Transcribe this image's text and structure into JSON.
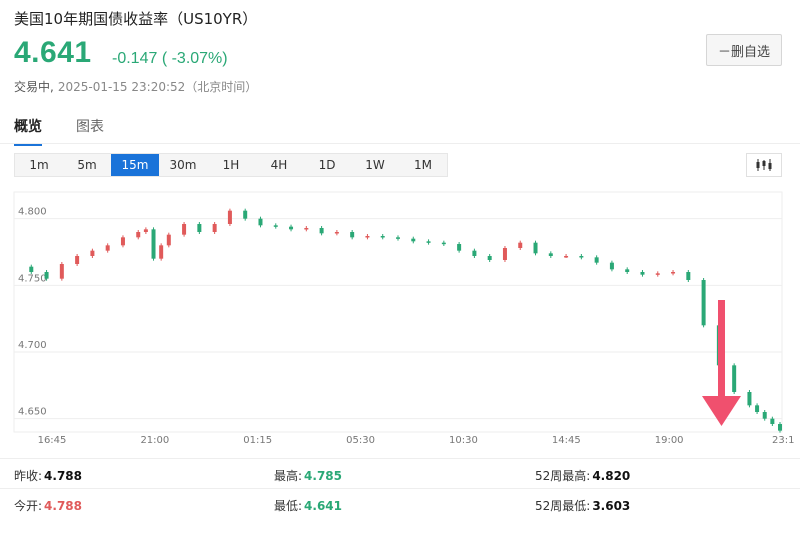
{
  "header": {
    "title": "美国10年期国债收益率（US10YR）",
    "price": "4.641",
    "change": "-0.147 ( -3.07%)",
    "status": "交易中,",
    "timestamp": "2025-01-15 23:20:52（北京时间）",
    "watchlist_label": "－删自选"
  },
  "tabs": [
    {
      "label": "概览",
      "active": true
    },
    {
      "label": "图表",
      "active": false
    }
  ],
  "periods": [
    {
      "label": "1m",
      "active": false
    },
    {
      "label": "5m",
      "active": false
    },
    {
      "label": "15m",
      "active": true
    },
    {
      "label": "30m",
      "active": false
    },
    {
      "label": "1H",
      "active": false
    },
    {
      "label": "4H",
      "active": false
    },
    {
      "label": "1D",
      "active": false
    },
    {
      "label": "1W",
      "active": false
    },
    {
      "label": "1M",
      "active": false
    }
  ],
  "chart_data": {
    "type": "line",
    "title": "",
    "xlabel": "",
    "ylabel": "",
    "x_ticks": [
      "16:45",
      "21:00",
      "01:15",
      "05:30",
      "10:30",
      "14:45",
      "19:00",
      "23:1"
    ],
    "y_ticks": [
      "4.800",
      "4.750",
      "4.700",
      "4.650"
    ],
    "ylim": [
      4.64,
      4.82
    ],
    "series": [
      {
        "x": [
          0,
          2,
          4,
          6,
          8,
          10,
          12,
          14,
          16,
          17,
          18,
          19,
          20,
          22,
          24,
          26,
          28,
          30,
          32,
          34,
          36,
          38,
          40,
          42,
          44,
          46,
          48,
          50,
          52,
          54,
          56,
          58,
          60,
          62,
          64,
          66,
          68,
          70,
          72,
          74,
          76,
          78,
          80,
          82,
          84,
          86,
          88,
          90,
          92,
          94,
          96,
          97,
          98,
          99,
          100
        ],
        "values": [
          4.764,
          4.76,
          4.755,
          4.766,
          4.772,
          4.776,
          4.78,
          4.786,
          4.79,
          4.792,
          4.77,
          4.78,
          4.788,
          4.796,
          4.79,
          4.796,
          4.806,
          4.8,
          4.795,
          4.794,
          4.792,
          4.793,
          4.789,
          4.79,
          4.786,
          4.787,
          4.786,
          4.785,
          4.783,
          4.782,
          4.781,
          4.776,
          4.772,
          4.769,
          4.778,
          4.782,
          4.774,
          4.772,
          4.772,
          4.771,
          4.767,
          4.762,
          4.76,
          4.758,
          4.759,
          4.76,
          4.754,
          4.72,
          4.69,
          4.67,
          4.66,
          4.655,
          4.65,
          4.646,
          4.641
        ]
      }
    ],
    "annotations": [
      "downward red arrow near the end of the series"
    ]
  },
  "stats": {
    "prev_close_label": "昨收:",
    "prev_close": "4.788",
    "open_label": "今开:",
    "open": "4.788",
    "high_label": "最高:",
    "high": "4.785",
    "low_label": "最低:",
    "low": "4.641",
    "wk52_high_label": "52周最高:",
    "wk52_high": "4.820",
    "wk52_low_label": "52周最低:",
    "wk52_low": "3.603"
  },
  "colors": {
    "up": "#e05a5a",
    "down": "#2aa876",
    "accent": "#1a73d9",
    "arrow": "#f0506e"
  }
}
